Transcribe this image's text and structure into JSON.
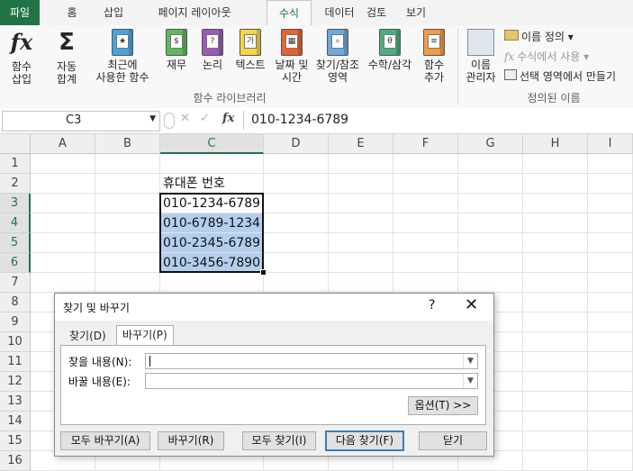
{
  "tabs": {
    "file": "파일",
    "home": "홈",
    "insert": "삽입",
    "layout": "페이지 레이아웃",
    "formulas": "수식",
    "data": "데이터",
    "review": "검토",
    "view": "보기"
  },
  "ribbon": {
    "insert_function": "함수\n삽입",
    "autosum": "자동\n합계",
    "recent": "최근에\n사용한 함수",
    "financial": "재무",
    "logical": "논리",
    "text": "텍스트",
    "datetime": "날짜 및\n시간",
    "lookup": "찾기/참조\n영역",
    "math": "수학/삼각",
    "more": "함수\n추가",
    "library_label": "함수 라이브러리",
    "name_manager": "이름\n관리자",
    "define_name": "이름 정의",
    "use_in_formula": "수식에서 사용",
    "create_from_selection": "선택 영역에서 만들기",
    "defined_names_label": "정의된 이름"
  },
  "formula_bar": {
    "name_box": "C3",
    "fx": "fx",
    "formula": "010-1234-6789"
  },
  "columns": [
    "A",
    "B",
    "C",
    "D",
    "E",
    "F",
    "G",
    "H",
    "I"
  ],
  "rows": [
    "1",
    "2",
    "3",
    "4",
    "5",
    "6",
    "7",
    "8",
    "9",
    "10",
    "11",
    "12",
    "13",
    "14",
    "15",
    "16"
  ],
  "cells": {
    "C2": "휴대폰 번호",
    "C3": "010-1234-6789",
    "C4": "010-6789-1234",
    "C5": "010-2345-6789",
    "C6": "010-3456-7890"
  },
  "dialog": {
    "title": "찾기 및 바꾸기",
    "help": "?",
    "close": "✕",
    "tab_find": "찾기(D)",
    "tab_replace": "바꾸기(P)",
    "find_label": "찾을 내용(N):",
    "find_value": "",
    "replace_label": "바꿀 내용(E):",
    "replace_value": "",
    "options": "옵션(T) >>",
    "replace_all": "모두 바꾸기(A)",
    "replace": "바꾸기(R)",
    "find_all": "모두 찾기(I)",
    "find_next": "다음 찾기(F)",
    "close_btn": "닫기"
  },
  "colors": {
    "accent": "#217346",
    "selection": "#b4cfee"
  }
}
